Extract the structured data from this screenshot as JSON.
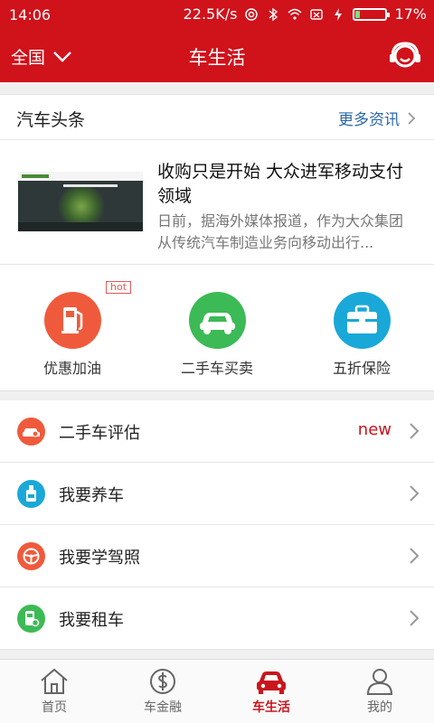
{
  "status_bar": {
    "time": "14:06",
    "network_speed": "22.5K/s",
    "battery_percent": "17%",
    "battery_level": 0.17
  },
  "header": {
    "region": "全国",
    "title": "车生活",
    "service_icon": "customer-service-icon"
  },
  "news": {
    "section_label": "汽车头条",
    "more_label": "更多资讯",
    "item": {
      "title": "收购只是开始 大众进军移动支付领域",
      "summary": "日前，据海外媒体报道，作为大众集团从传统汽车制造业务向移动出行..."
    }
  },
  "services": [
    {
      "label": "优惠加油",
      "icon": "fuel-pump-icon",
      "color": "#f05a3c",
      "tag": "hot"
    },
    {
      "label": "二手车买卖",
      "icon": "car-icon",
      "color": "#3cba55"
    },
    {
      "label": "五折保险",
      "icon": "briefcase-icon",
      "color": "#1aa8d8"
    }
  ],
  "list": [
    {
      "label": "二手车评估",
      "icon": "car-appraisal-icon",
      "color": "#f05a3c",
      "badge": "new"
    },
    {
      "label": "我要养车",
      "icon": "oil-bottle-icon",
      "color": "#1aa8d8",
      "badge": ""
    },
    {
      "label": "我要学驾照",
      "icon": "steering-wheel-icon",
      "color": "#f05a3c",
      "badge": ""
    },
    {
      "label": "我要租车",
      "icon": "car-key-icon",
      "color": "#3cba55",
      "badge": ""
    }
  ],
  "tabbar": [
    {
      "label": "首页",
      "icon": "home-icon",
      "active": false
    },
    {
      "label": "车金融",
      "icon": "finance-icon",
      "active": false
    },
    {
      "label": "车生活",
      "icon": "car-life-icon",
      "active": true
    },
    {
      "label": "我的",
      "icon": "profile-icon",
      "active": false
    }
  ],
  "colors": {
    "brand": "#d0121b",
    "link": "#2b69a6",
    "active_tab": "#c8161e"
  }
}
